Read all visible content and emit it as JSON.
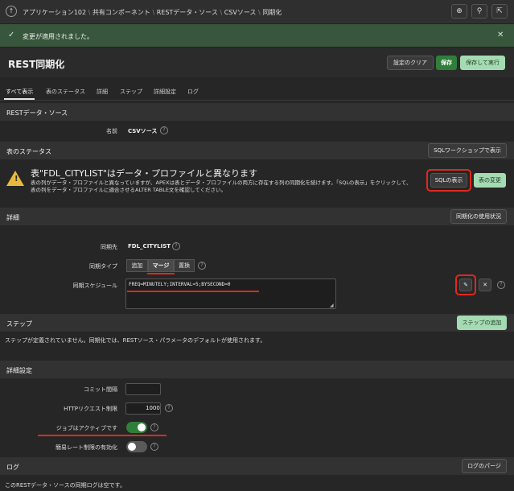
{
  "breadcrumb": {
    "items": [
      "アプリケーション102",
      "共有コンポーネント",
      "RESTデータ・ソース",
      "CSVソース",
      "同期化"
    ],
    "separator": "\\"
  },
  "toolbar": {
    "icons": [
      "dev-toolbar-icon",
      "wrench-icon",
      "share-icon"
    ]
  },
  "alert": {
    "message": "変更が適用されました。"
  },
  "page": {
    "title": "REST同期化"
  },
  "header_buttons": {
    "clear": "設定のクリア",
    "save": "保存",
    "save_run": "保存して実行"
  },
  "tabs": [
    "すべて表示",
    "表のステータス",
    "詳細",
    "ステップ",
    "詳細設定",
    "ログ"
  ],
  "rest_source": {
    "section_title": "RESTデータ・ソース",
    "name_label": "名前",
    "name_value": "CSVソース"
  },
  "table_status": {
    "section_title": "表のステータス",
    "workshop_button": "SQLワークショップで表示",
    "warning_title": "表\"FDL_CITYLIST\"はデータ・プロファイルと異なります",
    "warning_text": "表の列がデータ・プロファイルと異なっていますが、APEXは表とデータ・プロファイルの両方に存在する列の同期化を続けます。「SQLの表示」をクリックして、表の列をデータ・プロファイルに適合させるALTER TABLE文を確認してください。",
    "show_sql_button": "SQLの表示",
    "change_table_button": "表の変更"
  },
  "details": {
    "section_title": "詳細",
    "usage_button": "同期化の使用状況",
    "target_label": "同期先",
    "target_value": "FDL_CITYLIST",
    "type_label": "同期タイプ",
    "type_options": [
      "追加",
      "マージ",
      "置換"
    ],
    "type_selected": "マージ",
    "schedule_label": "同期スケジュール",
    "schedule_value": "FREQ=MINUTELY;INTERVAL=5;BYSECOND=0"
  },
  "steps": {
    "section_title": "ステップ",
    "add_button": "ステップの追加",
    "empty_text": "ステップが定義されていません。同期化では、RESTソース・パラメータのデフォルトが使用されます。"
  },
  "advanced": {
    "section_title": "詳細設定",
    "commit_label": "コミット間隔",
    "commit_value": "",
    "http_label": "HTTPリクエスト制限",
    "http_value": "1000",
    "job_active_label": "ジョブはアクティブです",
    "job_active": true,
    "rate_limit_label": "簡易レート制限の有効化",
    "rate_limit": false
  },
  "log": {
    "section_title": "ログ",
    "purge_button": "ログのパージ",
    "empty_text": "このRESTデータ・ソースの同期ログは空です。"
  },
  "colors": {
    "success": "#37563b",
    "accent_green": "#2f7f3b",
    "light_green": "#a5dbb2",
    "annotation_red": "#e0281e",
    "warning": "#e8b93a"
  }
}
